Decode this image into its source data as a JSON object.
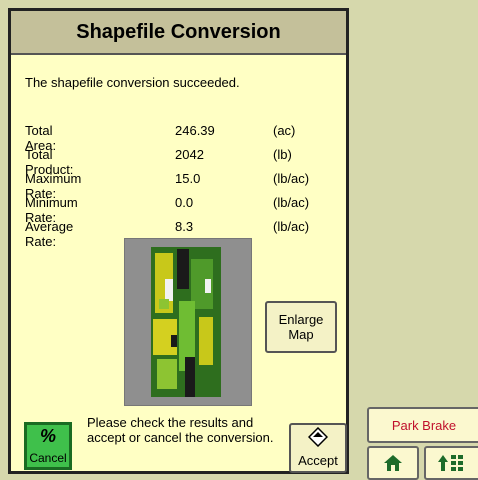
{
  "dialog": {
    "title": "Shapefile Conversion",
    "message": "The shapefile conversion succeeded.",
    "stats": [
      {
        "label": "Total Area:",
        "value": "246.39",
        "unit": "(ac)"
      },
      {
        "label": "Total Product:",
        "value": "2042",
        "unit": "(lb)"
      },
      {
        "label": "Maximum Rate:",
        "value": "15.0",
        "unit": "(lb/ac)"
      },
      {
        "label": "Minimum Rate:",
        "value": "0.0",
        "unit": "(lb/ac)"
      },
      {
        "label": "Average Rate:",
        "value": "8.3",
        "unit": "(lb/ac)"
      }
    ],
    "enlarge_label_1": "Enlarge",
    "enlarge_label_2": "Map",
    "instructions": "Please check the results and accept or cancel the conversion.",
    "cancel_label": "Cancel",
    "accept_label": "Accept"
  },
  "side": {
    "park_brake_label": "Park Brake"
  },
  "colors": {
    "dialog_bg": "#ffffc4",
    "title_bar": "#c4c09a",
    "cancel_green": "#3fc04b",
    "park_brake_text": "#c0102c",
    "screen_bg": "#d6d8ac"
  },
  "icons": {
    "cancel": "cancel-slash-icon",
    "accept": "accept-diamond-icon",
    "home": "home-icon",
    "menu": "menu-grid-icon"
  }
}
